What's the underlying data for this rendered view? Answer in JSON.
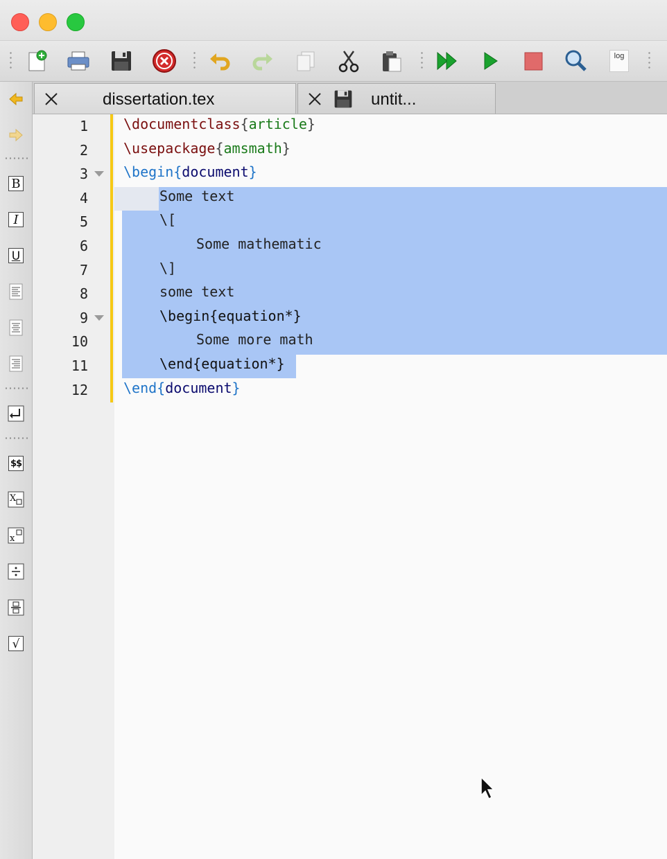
{
  "window": {
    "controls": [
      "close",
      "minimize",
      "zoom"
    ]
  },
  "toolbar": {
    "buttons": [
      "new-file-icon",
      "print-icon",
      "save-icon",
      "close-document-icon",
      "undo-icon",
      "redo-icon",
      "copy-icon",
      "cut-icon",
      "paste-icon",
      "build-and-view-icon",
      "compile-icon",
      "stop-icon",
      "find-icon",
      "log-icon"
    ],
    "log_label": "log"
  },
  "sidebar": {
    "bold_label": "B",
    "italic_label": "I",
    "underline_label": "U",
    "math_label": "$$",
    "sqrt_label": "√"
  },
  "tabs": [
    {
      "label": "dissertation.tex",
      "active": true
    },
    {
      "label": "untit...",
      "active": false
    }
  ],
  "editor": {
    "line_numbers": [
      "1",
      "2",
      "3",
      "4",
      "5",
      "6",
      "7",
      "8",
      "9",
      "10",
      "11",
      "12"
    ],
    "lines": {
      "l1_cmd": "\\documentclass",
      "l1_arg": "article",
      "l2_cmd": "\\usepackage",
      "l2_arg": "amsmath",
      "l3_cmd": "\\begin",
      "l3_arg": "document",
      "l4": "Some text",
      "l5": "\\[",
      "l6": "Some mathematic",
      "l7": "\\]",
      "l8": "some text",
      "l9": "\\begin{equation*}",
      "l10": "Some more math",
      "l11": "\\end{equation*}",
      "l12_cmd": "\\end",
      "l12_arg": "document"
    }
  },
  "colors": {
    "selection": "#a9c6f5",
    "fold_bar": "#f6c915",
    "command": "#7a0f0f",
    "argument": "#1a7a1a",
    "keyword": "#1f74c8",
    "environment": "#0b0b6e"
  }
}
